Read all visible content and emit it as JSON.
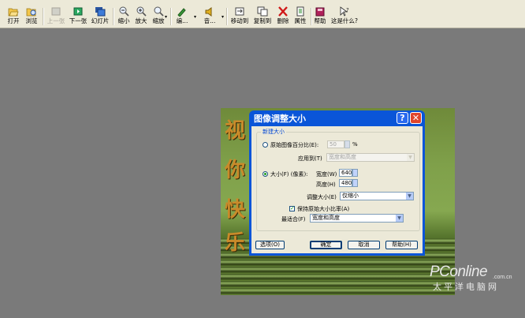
{
  "toolbar": {
    "items": [
      {
        "label": "打开",
        "icon": "folder-open-icon"
      },
      {
        "label": "浏览",
        "icon": "browse-icon"
      },
      {
        "label": "上一张",
        "icon": "previous-icon",
        "disabled": true
      },
      {
        "label": "下一张",
        "icon": "next-icon"
      },
      {
        "label": "幻灯片",
        "icon": "slideshow-icon"
      },
      {
        "label": "缩小",
        "icon": "zoom-out-icon"
      },
      {
        "label": "放大",
        "icon": "zoom-in-icon"
      },
      {
        "label": "缩放",
        "icon": "zoom-icon"
      },
      {
        "label": "编...",
        "icon": "edit-icon"
      },
      {
        "label": "音...",
        "icon": "audio-icon"
      },
      {
        "label": "移动到",
        "icon": "move-to-icon"
      },
      {
        "label": "复制到",
        "icon": "copy-to-icon"
      },
      {
        "label": "删除",
        "icon": "delete-icon"
      },
      {
        "label": "属性",
        "icon": "properties-icon"
      },
      {
        "label": "帮助",
        "icon": "help-book-icon"
      },
      {
        "label": "这是什么?",
        "icon": "whats-this-icon"
      }
    ]
  },
  "photo": {
    "glyphs": [
      "视",
      "你",
      "快",
      "乐"
    ]
  },
  "watermark": {
    "brand": "PConline",
    "domain": ".com.cn",
    "cn": "太平洋电脑网"
  },
  "dialog": {
    "title": "图像调整大小",
    "help_button": "?",
    "close_button": "✕",
    "group_label": "新建大小",
    "percent_radio": "原始图像百分比(E):",
    "percent_value": "50",
    "percent_unit": "%",
    "apply_label": "应用到(T)",
    "apply_value": "宽度和高度",
    "size_radio": "大小(F) (像素):",
    "width_label": "宽度(W)",
    "width_value": "640",
    "height_label": "高度(H)",
    "height_value": "480",
    "adjust_label": "调整大小(E)",
    "adjust_value": "仅缩小",
    "keep_ratio": "保持原始大小比率(A)",
    "fit_label": "最适合(F)",
    "fit_value": "宽度和高度",
    "options_button": "选项(O)",
    "ok_button": "确定",
    "cancel_button": "取消",
    "help_text_button": "帮助(H)"
  },
  "colors": {
    "toolbar_bg": "#ece9d8",
    "viewer_bg": "#7a7a7a",
    "dialog_title_blue": "#0a55d8",
    "close_red": "#e0462c"
  }
}
